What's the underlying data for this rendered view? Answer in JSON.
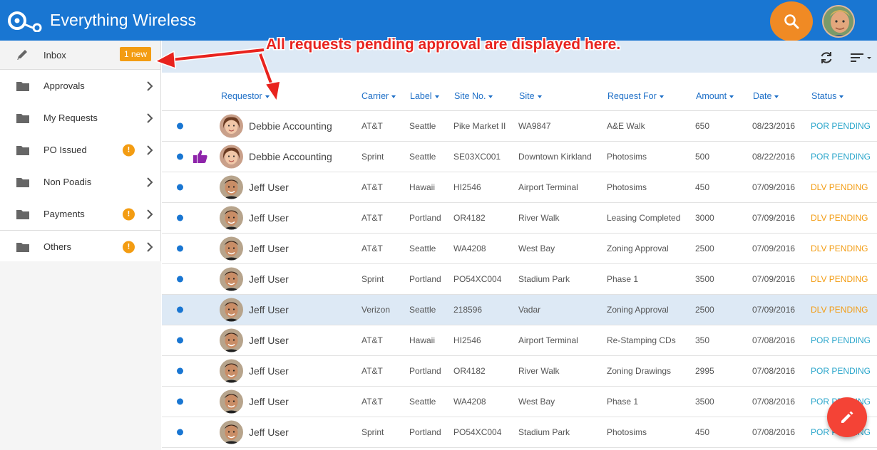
{
  "app": {
    "title": "Everything Wireless"
  },
  "colors": {
    "header": "#1976d2",
    "search_button": "#f08a24",
    "fab": "#f44336",
    "badge": "#f39c12",
    "por_pending": "#2ba6cb",
    "dlv_pending": "#f39c12",
    "annotation": "#e8231e"
  },
  "annotation": {
    "text": "All requests pending approval are displayed here."
  },
  "sidebar": {
    "items": [
      {
        "label": "Inbox",
        "icon": "pencil-icon",
        "badge": "1 new"
      },
      {
        "label": "Approvals",
        "icon": "folder-icon"
      },
      {
        "label": "My Requests",
        "icon": "folder-icon"
      },
      {
        "label": "PO Issued",
        "icon": "folder-icon",
        "alert": "!"
      },
      {
        "label": "Non Poadis",
        "icon": "folder-icon"
      },
      {
        "label": "Payments",
        "icon": "folder-icon",
        "alert": "!"
      },
      {
        "label": "Others",
        "icon": "folder-icon",
        "alert": "!"
      }
    ]
  },
  "table": {
    "columns": [
      "Requestor",
      "Carrier",
      "Label",
      "Site No.",
      "Site",
      "Request For",
      "Amount",
      "Date",
      "Status"
    ],
    "rows": [
      {
        "requestor": "Debbie Accounting",
        "avatar": "female",
        "liked": false,
        "carrier": "AT&T",
        "label": "Seattle",
        "site_no": "Pike Market II",
        "site": "WA9847",
        "request_for": "A&E Walk",
        "amount": "650",
        "date": "08/23/2016",
        "status": "POR PENDING",
        "status_type": "por",
        "selected": false
      },
      {
        "requestor": "Debbie Accounting",
        "avatar": "female",
        "liked": true,
        "carrier": "Sprint",
        "label": "Seattle",
        "site_no": "SE03XC001",
        "site": "Downtown Kirkland",
        "request_for": "Photosims",
        "amount": "500",
        "date": "08/22/2016",
        "status": "POR PENDING",
        "status_type": "por",
        "selected": false
      },
      {
        "requestor": "Jeff User",
        "avatar": "male",
        "liked": false,
        "carrier": "AT&T",
        "label": "Hawaii",
        "site_no": "HI2546",
        "site": "Airport Terminal",
        "request_for": "Photosims",
        "amount": "450",
        "date": "07/09/2016",
        "status": "DLV PENDING",
        "status_type": "dlv",
        "selected": false
      },
      {
        "requestor": "Jeff User",
        "avatar": "male",
        "liked": false,
        "carrier": "AT&T",
        "label": "Portland",
        "site_no": "OR4182",
        "site": "River Walk",
        "request_for": "Leasing Completed",
        "amount": "3000",
        "date": "07/09/2016",
        "status": "DLV PENDING",
        "status_type": "dlv",
        "selected": false
      },
      {
        "requestor": "Jeff User",
        "avatar": "male",
        "liked": false,
        "carrier": "AT&T",
        "label": "Seattle",
        "site_no": "WA4208",
        "site": "West Bay",
        "request_for": "Zoning Approval",
        "amount": "2500",
        "date": "07/09/2016",
        "status": "DLV PENDING",
        "status_type": "dlv",
        "selected": false
      },
      {
        "requestor": "Jeff User",
        "avatar": "male",
        "liked": false,
        "carrier": "Sprint",
        "label": "Portland",
        "site_no": "PO54XC004",
        "site": "Stadium Park",
        "request_for": "Phase 1",
        "amount": "3500",
        "date": "07/09/2016",
        "status": "DLV PENDING",
        "status_type": "dlv",
        "selected": false
      },
      {
        "requestor": "Jeff User",
        "avatar": "male",
        "liked": false,
        "carrier": "Verizon",
        "label": "Seattle",
        "site_no": "218596",
        "site": "Vadar",
        "request_for": "Zoning Approval",
        "amount": "2500",
        "date": "07/09/2016",
        "status": "DLV PENDING",
        "status_type": "dlv",
        "selected": true
      },
      {
        "requestor": "Jeff User",
        "avatar": "male",
        "liked": false,
        "carrier": "AT&T",
        "label": "Hawaii",
        "site_no": "HI2546",
        "site": "Airport Terminal",
        "request_for": "Re-Stamping CDs",
        "amount": "350",
        "date": "07/08/2016",
        "status": "POR PENDING",
        "status_type": "por",
        "selected": false
      },
      {
        "requestor": "Jeff User",
        "avatar": "male",
        "liked": false,
        "carrier": "AT&T",
        "label": "Portland",
        "site_no": "OR4182",
        "site": "River Walk",
        "request_for": "Zoning Drawings",
        "amount": "2995",
        "date": "07/08/2016",
        "status": "POR PENDING",
        "status_type": "por",
        "selected": false
      },
      {
        "requestor": "Jeff User",
        "avatar": "male",
        "liked": false,
        "carrier": "AT&T",
        "label": "Seattle",
        "site_no": "WA4208",
        "site": "West Bay",
        "request_for": "Phase 1",
        "amount": "3500",
        "date": "07/08/2016",
        "status": "POR PENDING",
        "status_type": "por",
        "selected": false
      },
      {
        "requestor": "Jeff User",
        "avatar": "male",
        "liked": false,
        "carrier": "Sprint",
        "label": "Portland",
        "site_no": "PO54XC004",
        "site": "Stadium Park",
        "request_for": "Photosims",
        "amount": "450",
        "date": "07/08/2016",
        "status": "POR PENDING",
        "status_type": "por",
        "selected": false
      }
    ]
  }
}
